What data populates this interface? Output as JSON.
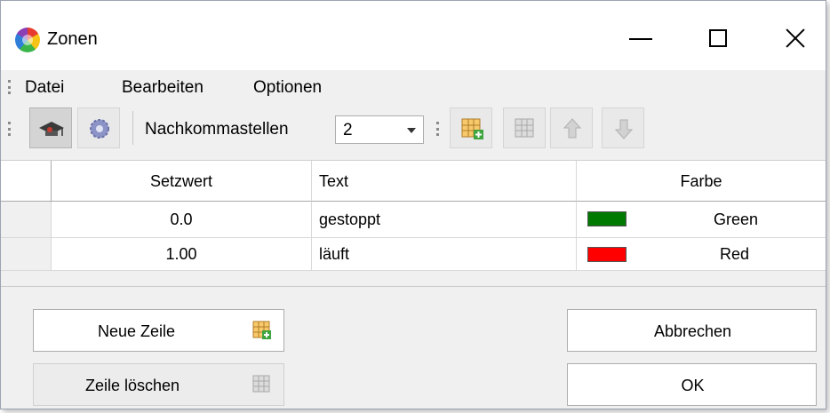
{
  "window": {
    "title": "Zonen"
  },
  "menu": {
    "items": [
      "Datei",
      "Bearbeiten",
      "Optionen"
    ]
  },
  "toolbar": {
    "decimals_label": "Nachkommastellen",
    "decimals_value": "2"
  },
  "table": {
    "columns": [
      "Setzwert",
      "Text",
      "Farbe"
    ],
    "rows": [
      {
        "setzwert": "0.0",
        "text": "gestoppt",
        "color_name": "Green",
        "color_hex": "#007a00"
      },
      {
        "setzwert": "1.00",
        "text": "läuft",
        "color_name": "Red",
        "color_hex": "#ff0000"
      }
    ]
  },
  "buttons": {
    "new_row": "Neue Zeile",
    "delete_row": "Zeile löschen",
    "cancel": "Abbrechen",
    "ok": "OK"
  }
}
